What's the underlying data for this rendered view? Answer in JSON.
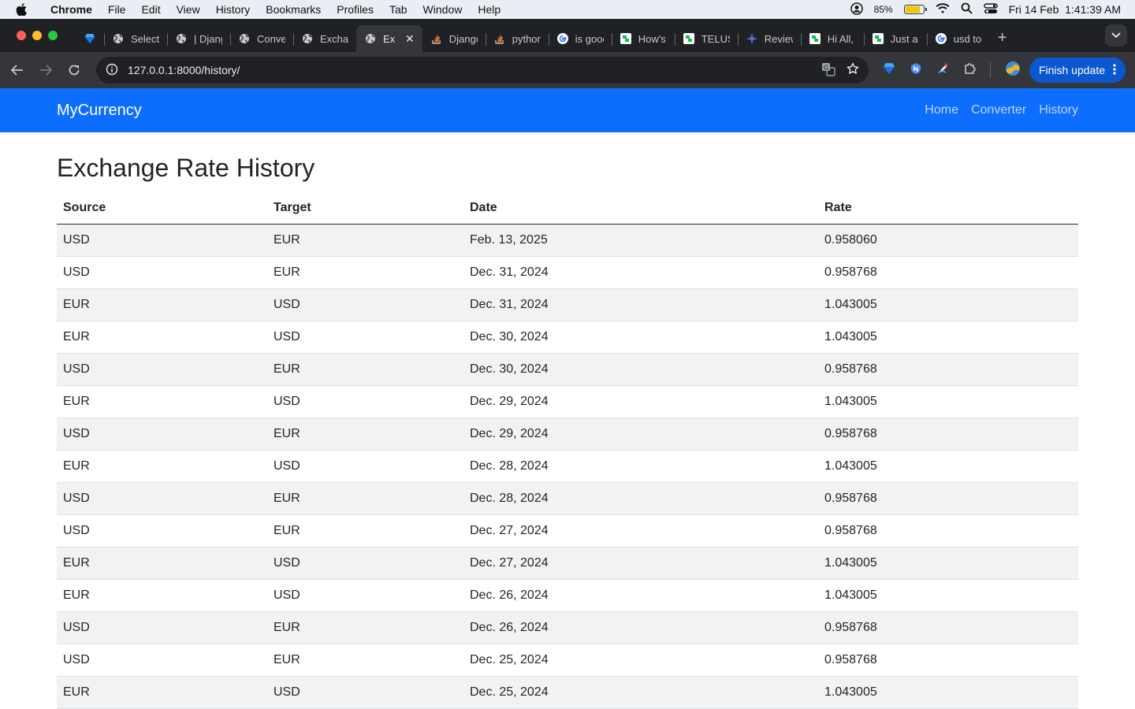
{
  "menubar": {
    "app": "Chrome",
    "items": [
      "File",
      "Edit",
      "View",
      "History",
      "Bookmarks",
      "Profiles",
      "Tab",
      "Window",
      "Help"
    ],
    "battery": "85%",
    "battery_level": 0.85,
    "datetime": "Fri 14 Feb  1:41:39 AM"
  },
  "tabs": [
    {
      "title": "",
      "icon": "gem-icon"
    },
    {
      "title": "Select",
      "icon": "globe-icon"
    },
    {
      "title": "| Djang",
      "icon": "globe-icon"
    },
    {
      "title": "Conve",
      "icon": "globe-icon"
    },
    {
      "title": "Exchar",
      "icon": "globe-icon"
    },
    {
      "title": "Ex",
      "icon": "globe-icon",
      "active": true
    },
    {
      "title": "Djangc",
      "icon": "stackoverflow-icon"
    },
    {
      "title": "python",
      "icon": "stackoverflow-icon"
    },
    {
      "title": "is gooc",
      "icon": "google-icon"
    },
    {
      "title": "How's",
      "icon": "green-doc-icon"
    },
    {
      "title": "TELUS",
      "icon": "green-doc-icon"
    },
    {
      "title": "Review",
      "icon": "star-icon"
    },
    {
      "title": "Hi All,",
      "icon": "green-doc-icon"
    },
    {
      "title": "Just a",
      "icon": "green-doc-icon"
    },
    {
      "title": "usd to",
      "icon": "google-icon"
    }
  ],
  "toolbar": {
    "url": "127.0.0.1:8000/history/",
    "update_label": "Finish update"
  },
  "site": {
    "brand": "MyCurrency",
    "nav": [
      "Home",
      "Converter",
      "History"
    ]
  },
  "page": {
    "title": "Exchange Rate History",
    "columns": [
      "Source",
      "Target",
      "Date",
      "Rate"
    ],
    "rows": [
      [
        "USD",
        "EUR",
        "Feb. 13, 2025",
        "0.958060"
      ],
      [
        "USD",
        "EUR",
        "Dec. 31, 2024",
        "0.958768"
      ],
      [
        "EUR",
        "USD",
        "Dec. 31, 2024",
        "1.043005"
      ],
      [
        "EUR",
        "USD",
        "Dec. 30, 2024",
        "1.043005"
      ],
      [
        "USD",
        "EUR",
        "Dec. 30, 2024",
        "0.958768"
      ],
      [
        "EUR",
        "USD",
        "Dec. 29, 2024",
        "1.043005"
      ],
      [
        "USD",
        "EUR",
        "Dec. 29, 2024",
        "0.958768"
      ],
      [
        "EUR",
        "USD",
        "Dec. 28, 2024",
        "1.043005"
      ],
      [
        "USD",
        "EUR",
        "Dec. 28, 2024",
        "0.958768"
      ],
      [
        "USD",
        "EUR",
        "Dec. 27, 2024",
        "0.958768"
      ],
      [
        "EUR",
        "USD",
        "Dec. 27, 2024",
        "1.043005"
      ],
      [
        "EUR",
        "USD",
        "Dec. 26, 2024",
        "1.043005"
      ],
      [
        "USD",
        "EUR",
        "Dec. 26, 2024",
        "0.958768"
      ],
      [
        "USD",
        "EUR",
        "Dec. 25, 2024",
        "0.958768"
      ],
      [
        "EUR",
        "USD",
        "Dec. 25, 2024",
        "1.043005"
      ]
    ]
  },
  "colors": {
    "navbar": "#0d6efd",
    "chrome_dark": "#202124",
    "chrome_toolbar": "#35363a",
    "update_button": "#0b57d0"
  }
}
